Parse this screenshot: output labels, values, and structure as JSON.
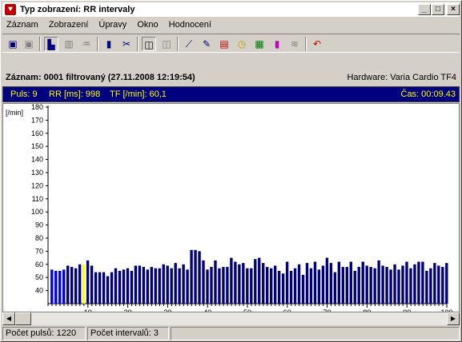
{
  "window": {
    "title": "Typ zobrazení: RR intervaly",
    "controls": [
      "_",
      "□",
      "×"
    ]
  },
  "menu": [
    "Záznam",
    "Zobrazení",
    "Úpravy",
    "Okno",
    "Hodnocení"
  ],
  "toolbar_icons": [
    "save-icon",
    "save-disabled-icon",
    "histogram-icon",
    "bars-disabled-icon",
    "filter-disabled-icon",
    "bar-chart-icon",
    "scissors-icon",
    "graph-window-icon",
    "graph-window2-icon",
    "line-chart-icon",
    "edit-chart-icon",
    "report-icon",
    "clock-icon",
    "grid-icon",
    "color-bars-icon",
    "wave-icon",
    "undo-icon"
  ],
  "info": {
    "record": "Záznam: 0001 filtrovaný  (27.11.2008 12:19:54)",
    "hardware": "Hardware: Varia Cardio TF4"
  },
  "live": {
    "pulse": "Puls: 9",
    "rr": "RR [ms]: 998",
    "tf": "TF [/min]: 60,1",
    "time": "Čas: 00:09.43"
  },
  "status": {
    "pulses": "Počet pulsů: 1220",
    "intervals": "Počet intervalů: 3"
  },
  "chart_data": {
    "type": "bar",
    "ylabel": "[/min]",
    "ylim": [
      30,
      180
    ],
    "y_ticks": [
      40,
      50,
      60,
      70,
      80,
      90,
      100,
      110,
      120,
      130,
      140,
      150,
      160,
      170,
      180
    ],
    "x_ticks": [
      10,
      20,
      30,
      40,
      50,
      60,
      70,
      80,
      90,
      100
    ],
    "xlim": [
      0,
      100
    ],
    "values": [
      56,
      55,
      55,
      56,
      59,
      58,
      57,
      60,
      60,
      63,
      59,
      54,
      54,
      54,
      51,
      54,
      57,
      55,
      56,
      57,
      55,
      59,
      59,
      58,
      56,
      58,
      57,
      57,
      60,
      59,
      57,
      61,
      57,
      60,
      56,
      71,
      71,
      70,
      63,
      56,
      58,
      63,
      57,
      58,
      58,
      65,
      62,
      60,
      61,
      57,
      57,
      64,
      65,
      61,
      58,
      57,
      59,
      55,
      53,
      62,
      55,
      57,
      60,
      52,
      61,
      57,
      62,
      56,
      59,
      65,
      61,
      54,
      62,
      58,
      58,
      62,
      55,
      58,
      62,
      59,
      58,
      57,
      63,
      59,
      58,
      56,
      60,
      56,
      59,
      62,
      57,
      60,
      62,
      62,
      55,
      57,
      61,
      59,
      58,
      61
    ],
    "highlight": {
      "blue_bars": [
        1,
        2,
        3,
        4
      ],
      "yellow_bar": 9
    },
    "colors": {
      "bar": "#000080",
      "blue": "#0000ff",
      "yellow": "#ffff00"
    }
  }
}
